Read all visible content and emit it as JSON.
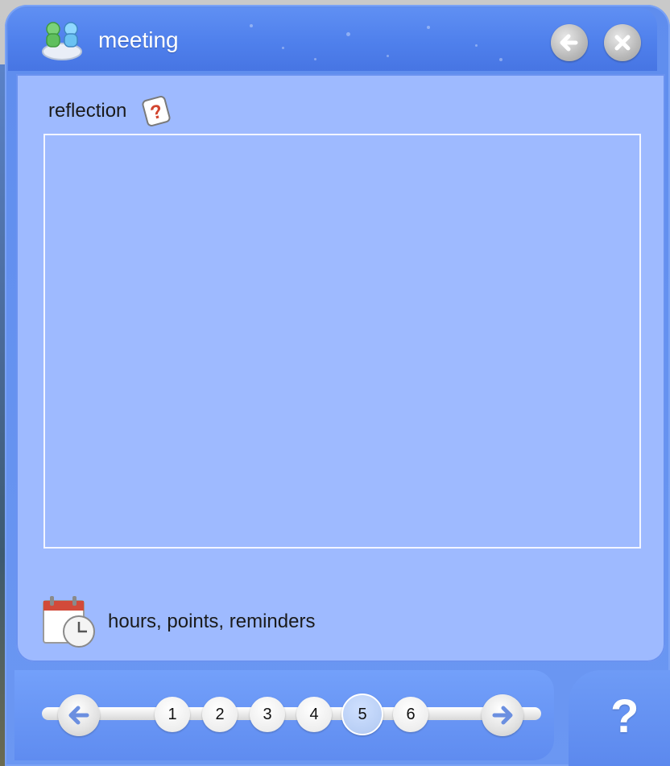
{
  "window": {
    "title": "meeting",
    "icons": {
      "app": "meeting-people-icon",
      "back": "back-arrow-icon",
      "close": "close-icon"
    }
  },
  "main": {
    "reflection_label": "reflection",
    "reflection_help_icon": "question-badge-icon",
    "reflection_text": "",
    "hours_label": "hours, points, reminders",
    "hours_icon": "calendar-clock-icon"
  },
  "pager": {
    "prev_icon": "arrow-left-icon",
    "next_icon": "arrow-right-icon",
    "pages": [
      "1",
      "2",
      "3",
      "4",
      "5",
      "6"
    ],
    "current": "5"
  },
  "help": {
    "label": "?"
  },
  "colors": {
    "panel": "#9ebaff",
    "titlebar": "#4f80ec",
    "accent": "#5f8dee"
  }
}
